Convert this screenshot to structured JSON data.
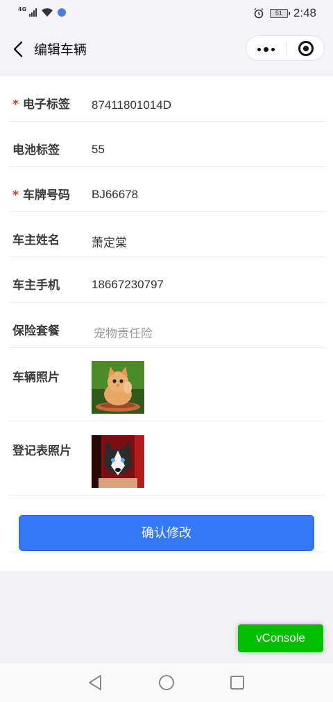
{
  "status_bar": {
    "network": "4G",
    "battery": "51",
    "time": "2:48"
  },
  "nav": {
    "title": "编辑车辆"
  },
  "form": {
    "rows": [
      {
        "label": "电子标签",
        "required": true,
        "value": "87411801014D"
      },
      {
        "label": "电池标签",
        "required": false,
        "value": "55"
      },
      {
        "label": "车牌号码",
        "required": true,
        "value": "BJ66678"
      },
      {
        "label": "车主姓名",
        "required": false,
        "value": "萧定棠"
      },
      {
        "label": "车主手机",
        "required": false,
        "value": "18667230797"
      },
      {
        "label": "保险套餐",
        "required": false,
        "value": "宠物责任险"
      },
      {
        "label": "车辆照片",
        "required": false,
        "image": "kitten-photo"
      },
      {
        "label": "登记表照片",
        "required": false,
        "image": "husky-puppy-photo"
      }
    ],
    "required_mark": "*",
    "submit_label": "确认修改"
  },
  "vconsole": {
    "label": "vConsole"
  },
  "colors": {
    "primary": "#3478f6",
    "required": "#e0342c",
    "vconsole": "#04be02"
  },
  "icons": [
    "back-arrow-icon",
    "more-dots-icon",
    "close-miniprogram-icon",
    "triangle-back-icon",
    "circle-home-icon",
    "square-recents-icon"
  ]
}
